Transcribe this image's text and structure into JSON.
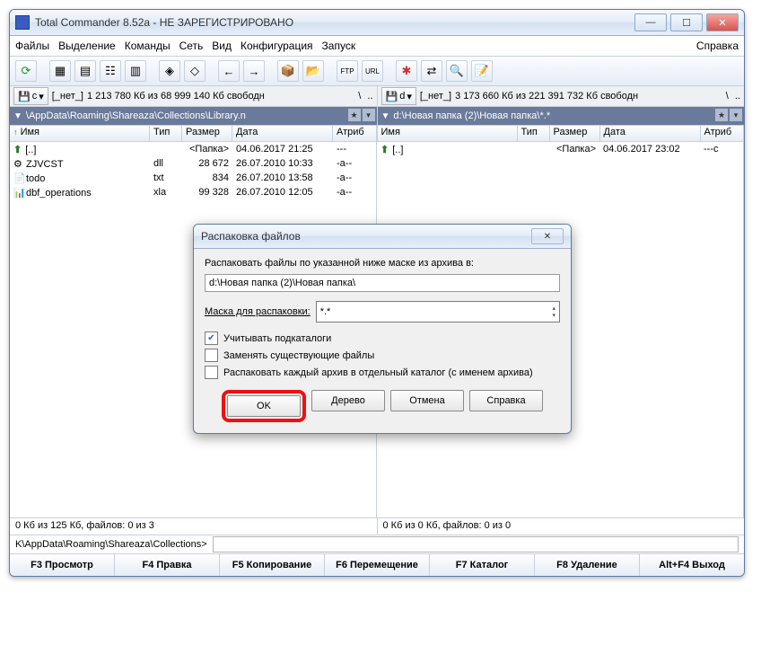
{
  "titlebar": {
    "title": "Total Commander 8.52a - НЕ ЗАРЕГИСТРИРОВАНО"
  },
  "menu": {
    "files": "Файлы",
    "selection": "Выделение",
    "commands": "Команды",
    "network": "Сеть",
    "view": "Вид",
    "config": "Конфигурация",
    "start": "Запуск",
    "help": "Справка"
  },
  "left": {
    "drive": "c",
    "drive_label": "[_нет_]",
    "space": "1 213 780 Кб из 68 999 140 Кб свободн",
    "path": "\\AppData\\Roaming\\Shareaza\\Collections\\Library.n",
    "cols": {
      "name": "Имя",
      "type": "Тип",
      "size": "Размер",
      "date": "Дата",
      "attr": "Атриб"
    },
    "updir": "[..]",
    "updir_size": "<Папка>",
    "updir_date": "04.06.2017 21:25",
    "updir_attr": "---",
    "files": [
      {
        "name": "ZJVCST",
        "ext": "dll",
        "size": "28 672",
        "date": "26.07.2010 10:33",
        "attr": "-a--"
      },
      {
        "name": "todo",
        "ext": "txt",
        "size": "834",
        "date": "26.07.2010 13:58",
        "attr": "-a--"
      },
      {
        "name": "dbf_operations",
        "ext": "xla",
        "size": "99 328",
        "date": "26.07.2010 12:05",
        "attr": "-a--"
      }
    ],
    "status": "0 Кб из 125 Кб, файлов: 0 из 3"
  },
  "right": {
    "drive": "d",
    "drive_label": "[_нет_]",
    "space": "3 173 660 Кб из 221 391 732 Кб свободн",
    "path": "d:\\Новая папка (2)\\Новая папка\\*.*",
    "cols": {
      "name": "Имя",
      "type": "Тип",
      "size": "Размер",
      "date": "Дата",
      "attr": "Атриб"
    },
    "updir": "[..]",
    "updir_size": "<Папка>",
    "updir_date": "04.06.2017 23:02",
    "updir_attr": "---c",
    "status": "0 Кб из 0 Кб, файлов: 0 из 0"
  },
  "cmdline": "K\\AppData\\Roaming\\Shareaza\\Collections>",
  "func": {
    "f3": "F3 Просмотр",
    "f4": "F4 Правка",
    "f5": "F5 Копирование",
    "f6": "F6 Перемещение",
    "f7": "F7 Каталог",
    "f8": "F8 Удаление",
    "af4": "Alt+F4 Выход"
  },
  "dialog": {
    "title": "Распаковка файлов",
    "label": "Распаковать файлы по указанной ниже маске из архива в:",
    "path": "d:\\Новая папка (2)\\Новая папка\\",
    "mask_label": "Маска для распаковки:",
    "mask_value": "*.*",
    "opt_subdirs": "Учитывать подкаталоги",
    "opt_overwrite": "Заменять существующие файлы",
    "opt_separate": "Распаковать каждый архив в отдельный каталог (с именем архива)",
    "ok": "OK",
    "tree": "Дерево",
    "cancel": "Отмена",
    "help": "Справка"
  }
}
